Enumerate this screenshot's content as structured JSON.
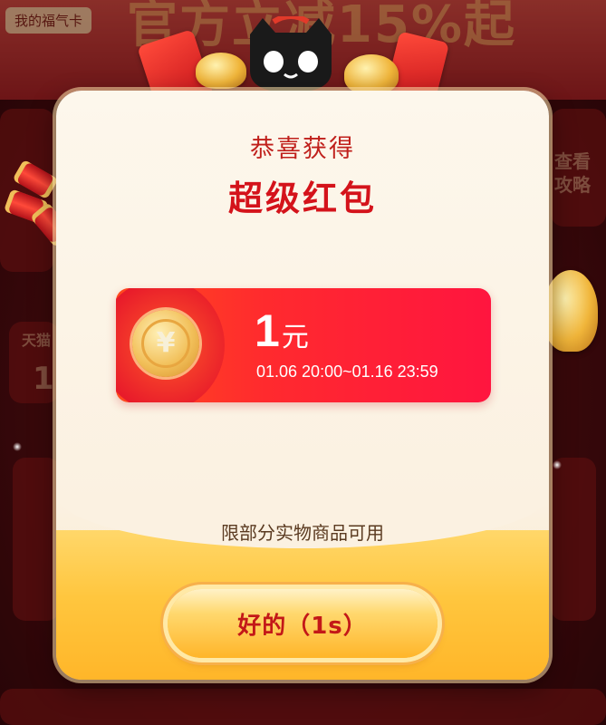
{
  "background": {
    "fuka_label": "我的福气卡",
    "banner_text": "官方立减15%起",
    "left_side_text": "天猫",
    "left_side_num": "1",
    "right_side_text": "查看攻略"
  },
  "modal": {
    "title_small": "恭喜获得",
    "title_big": "超级红包",
    "coupon": {
      "currency_icon": "yen-coin-icon",
      "currency_symbol": "¥",
      "amount": "1",
      "unit": "元",
      "validity": "01.06 20:00~01.16 23:59"
    },
    "note": "限部分实物商品可用",
    "ok_button_label": "好的（1s）"
  },
  "colors": {
    "accent_red": "#d4131b",
    "coupon_red": "#ff2a2e",
    "button_gold": "#ffc63e"
  }
}
